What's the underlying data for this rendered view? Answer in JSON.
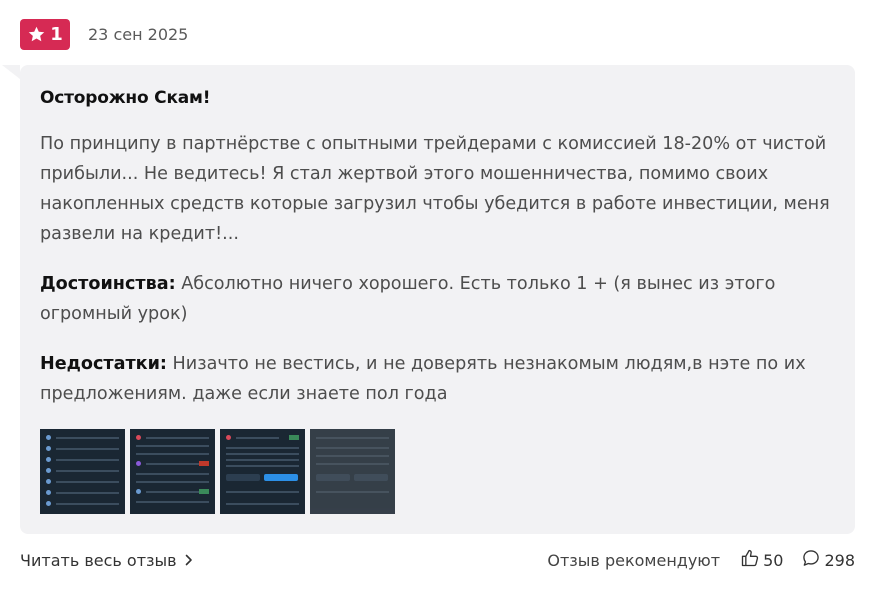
{
  "header": {
    "badge_value": "1",
    "date": "23 сен 2025"
  },
  "review": {
    "title": "Осторожно Скам!",
    "body": "По принципу в партнёрстве с опытными трейдерами с комиссией 18-20% от чистой прибыли... Не ведитесь! Я стал жертвой этого мошенничества, помимо своих накопленных средств которые загрузил чтобы убедится в работе инвестиции, меня развели на кредит!...",
    "pros_label": "Достоинства:",
    "pros_text": " Абсолютно ничего хорошего. Есть только 1 + (я вынес из этого огромный урок)",
    "cons_label": "Недостатки:",
    "cons_text": " Низачто не вестись, и не доверять незнакомым людям,в нэте по их предложениям. даже если знаете пол года"
  },
  "footer": {
    "read_more": "Читать весь отзыв",
    "recommend_label": "Отзыв рекомендуют",
    "likes": "50",
    "comments": "298"
  },
  "colors": {
    "badge": "#d62a54",
    "card_bg": "#f2f2f4",
    "thumb_bg": "#1a2733"
  }
}
